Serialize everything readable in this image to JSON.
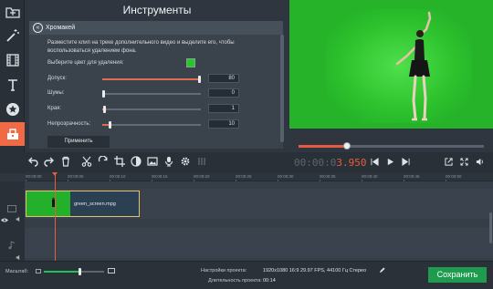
{
  "app": {
    "title": "Инструменты"
  },
  "panel": {
    "header": "Хромакей",
    "description": "Разместите клип на треке дополнительного видео и выделите его, чтобы воспользоваться удалением фона.",
    "color_label": "Выберите цвет для удаления:",
    "key_color": "#1fcc1f",
    "sliders": [
      {
        "label": "Допуск:",
        "value": "80",
        "fraction": 0.99
      },
      {
        "label": "Шумы:",
        "value": "0",
        "fraction": 0.01
      },
      {
        "label": "Края:",
        "value": "1",
        "fraction": 0.02
      },
      {
        "label": "Непрозрачность:",
        "value": "10",
        "fraction": 0.08
      }
    ],
    "apply_label": "Применить"
  },
  "player": {
    "timecode_dim": "00:00:0",
    "timecode_bright": "3.950",
    "progress": 0.26
  },
  "ruler": {
    "labels": [
      "00:00:00",
      "00:00:05",
      "00:00:10",
      "00:00:15",
      "00:00:20",
      "00:00:25",
      "00:00:30",
      "00:00:35",
      "00:00:40",
      "00:00:45",
      "00:00:50",
      "00:00:55"
    ]
  },
  "clip": {
    "name": "green_screen.mpg"
  },
  "bottom": {
    "zoom_label": "Масштаб:",
    "zoom_level": 0.6,
    "settings_label": "Настройки проекта:",
    "settings_value": "1920x1080 16:9 29.97 FPS, 44100 Гц Стерео",
    "duration_label": "Длительность проекта:",
    "duration_value": "00:14",
    "save_label": "Сохранить"
  },
  "colors": {
    "accent": "#e65e41",
    "save": "#1e9b4f",
    "chroma": "#26b32a"
  }
}
